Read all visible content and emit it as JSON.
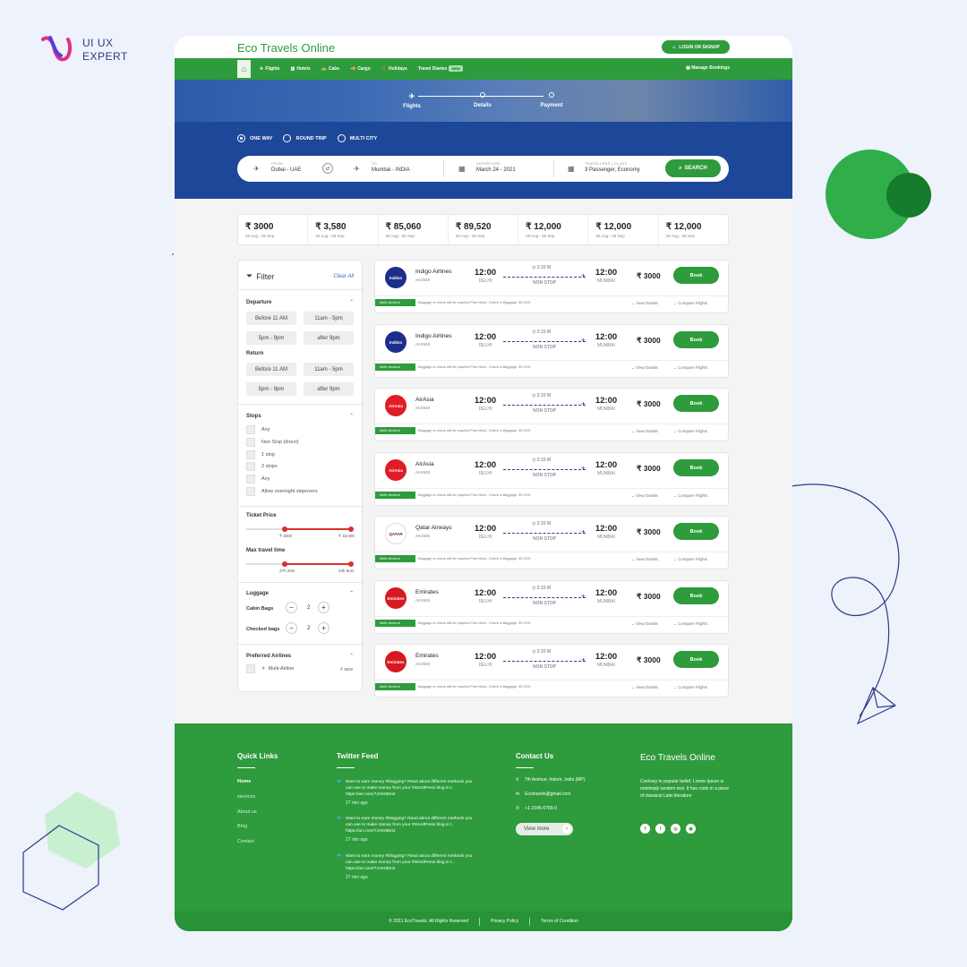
{
  "brand": {
    "name_line1": "UI UX",
    "name_line2": "EXPERT"
  },
  "header": {
    "logo": "Eco Travels Online",
    "login": "LOGIN OR SIGNUP"
  },
  "nav": {
    "items": [
      {
        "icon": "✈",
        "label": "Flights"
      },
      {
        "icon": "▥",
        "label": "Hotels"
      },
      {
        "icon": "🚕",
        "label": "Cabs"
      },
      {
        "icon": "🚚",
        "label": "Cargo"
      },
      {
        "icon": "🌴",
        "label": "Holidays"
      },
      {
        "icon": "",
        "label": "Travel Diaries"
      }
    ],
    "new_badge": "NEW",
    "manage": "Manage Bookings"
  },
  "steps": [
    "Flights",
    "Details",
    "Payment"
  ],
  "trip_types": [
    {
      "label": "ONE WAY",
      "selected": true
    },
    {
      "label": "ROUND TRIP",
      "selected": false
    },
    {
      "label": "MULTI CITY",
      "selected": false
    }
  ],
  "search": {
    "from_label": "FROM",
    "from": "Dubai - UAE",
    "to_label": "TO",
    "to": "Mumbai - INDIA",
    "dep_label": "DEPARTURE",
    "dep": "March 24 - 2021",
    "trav_label": "TRAVELLERS | CLASS",
    "trav": "3 Passenger, Economy",
    "button": "SEARCH"
  },
  "fares": [
    {
      "p": "₹ 3000",
      "d": "26 Aug - 05 Sep"
    },
    {
      "p": "₹ 3,580",
      "d": "26 Aug - 05 Sep"
    },
    {
      "p": "₹ 85,060",
      "d": "26 Aug - 05 Sep"
    },
    {
      "p": "₹ 89,520",
      "d": "26 Aug - 05 Sep"
    },
    {
      "p": "₹ 12,000",
      "d": "26 Aug - 05 Sep"
    },
    {
      "p": "₹ 12,000",
      "d": "26 Aug - 05 Sep"
    },
    {
      "p": "₹ 12,000",
      "d": "26 Aug - 05 Sep"
    }
  ],
  "filter": {
    "title": "Filter",
    "clear": "Clear All",
    "departure": "Departure",
    "return": "Return",
    "dep_times": [
      "Before 11 AM",
      "11am - 5pm",
      "5pm - 9pm",
      "after 9pm"
    ],
    "ret_times": [
      "Before 11 AM",
      "11am - 5pm",
      "5pm - 9pm",
      "after 9pm"
    ],
    "stops": "Stops",
    "stop_options": [
      "Any",
      "Non Stop (direct)",
      "1 stop",
      "2 stops",
      "Any",
      "Allow overnight stopovers"
    ],
    "ticket_price": "Ticket Price",
    "price_min": "₹ 3000",
    "price_max": "₹ 15,000",
    "max_time": "Max travel time",
    "time_min": "27h 25m",
    "time_max": "24h 9om",
    "luggage": "Luggage",
    "cabin": "Cabin Bags",
    "cabin_val": "2",
    "checked": "Checked bags",
    "checked_val": "2",
    "pref": "Preferred Airlines",
    "pref_item": "Multi-Airline",
    "pref_price": "₹ 3000"
  },
  "flight_common": {
    "dep_time": "12:00",
    "dep_city": "DELHI",
    "arr_time": "12:00",
    "arr_city": "MUMBAI",
    "duration": "2:10 M",
    "stops": "NON STOP",
    "price": "₹ 3000",
    "book": "Book",
    "badge": "Multi check-in",
    "note": "Baggage re-check will be required Free Meal - Check in Baggage: 30 KGS",
    "view": "View Details",
    "compare": "Compare Flights"
  },
  "flights": [
    {
      "name": "Indigo Airlines",
      "code": "AK2928",
      "logo": "IndiGo",
      "color": "#1d2d8c"
    },
    {
      "name": "Indigo Airlines",
      "code": "AK2928",
      "logo": "IndiGo",
      "color": "#1d2d8c"
    },
    {
      "name": "AirAsia",
      "code": "AK2928",
      "logo": "AirAsia",
      "color": "#e01c24"
    },
    {
      "name": "AirAsia",
      "code": "AK2928",
      "logo": "AirAsia",
      "color": "#e01c24"
    },
    {
      "name": "Qatar Airways",
      "code": "AK2928",
      "logo": "QATAR",
      "color": "#ffffff"
    },
    {
      "name": "Emirates",
      "code": "AK2928",
      "logo": "Emirates",
      "color": "#d71921"
    },
    {
      "name": "Emirates",
      "code": "AK2928",
      "logo": "Emirates",
      "color": "#d71921"
    }
  ],
  "footer": {
    "quick_title": "Quick Links",
    "quick": [
      "Home",
      "services",
      "About us",
      "Blog",
      "Contact"
    ],
    "twitter_title": "Twitter Feed",
    "tweets": [
      {
        "text": "Want to earn money #blogging? Read about different methods you can use to make money from your #WordPress blog in t.. https://arr.com/7JAK0B4i4",
        "ago": "27 min ago"
      },
      {
        "text": "Want to earn money #blogging? Read about different methods you can use to make money from your #WordPress blog in t.. https://arr.com/7JAK0B4i4",
        "ago": "27 min ago"
      },
      {
        "text": "Want to earn money #blogging? Read about different methods you can use to make money from your #WordPress blog in t.. https://arr.com/7JAK0B4i4",
        "ago": "27 min ago"
      }
    ],
    "contact_title": "Contact Us",
    "address": "7th Avenue, Indore, India (MP).",
    "email": "Ecotravels@gmail.com",
    "phone": "+1-2345-6789-0",
    "view_more": "View more",
    "logo": "Eco Travels Online",
    "about": "Contrary to popular belief, Lorem Ipsum is notsimply random text. It has roots in a piece of classical Latin literature",
    "social": [
      "f",
      "t",
      "◎",
      "◉"
    ],
    "copyright": "© 2021 EcoTravels. All Rights Reserved",
    "privacy": "Privacy Policy",
    "terms": "Terms of Condition"
  },
  "colors": {
    "green": "#2e9b3c",
    "blue": "#1d4798",
    "red": "#d6322e"
  }
}
